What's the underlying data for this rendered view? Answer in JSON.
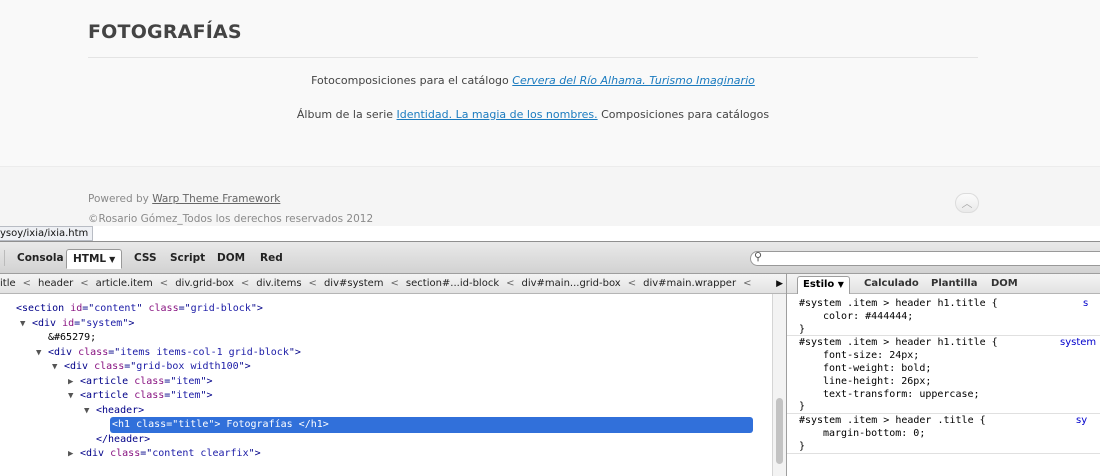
{
  "page": {
    "title": "FOTOGRAFÍAS",
    "para1_text": "Fotocomposiciones para el catálogo ",
    "para1_link": "Cervera del Río Alhama. Turismo Imaginario",
    "para2_text_before": "Álbum de la serie ",
    "para2_link": "Identidad. La magia de los nombres.",
    "para2_text_after": " Composiciones para catálogos",
    "footer_powered_prefix": "Powered by ",
    "footer_powered_link": "Warp Theme Framework",
    "footer_copyright": "©Rosario Gómez_Todos los derechos reservados 2012",
    "to_top_icon": "chevron-up-icon",
    "status_url": "ysoy/ixia/ixia.htm"
  },
  "firebug": {
    "tabs": [
      {
        "label": "Consola"
      },
      {
        "label": "HTML",
        "active": true
      },
      {
        "label": "CSS"
      },
      {
        "label": "Script"
      },
      {
        "label": "DOM"
      },
      {
        "label": "Red"
      }
    ],
    "search_icon": "search-icon",
    "breadcrumbs": [
      "itle",
      "header",
      "article.item",
      "div.grid-box",
      "div.items",
      "div#system",
      "section#...id-block",
      "div#main...grid-box",
      "div#main.wrapper"
    ],
    "breadcrumb_sep": "<",
    "tree": [
      {
        "indent": 0,
        "twisty": "",
        "parts": [
          [
            "c-tag",
            "<section "
          ],
          [
            "c-attr",
            "id"
          ],
          [
            "c-tag",
            "=\""
          ],
          [
            "c-val",
            "content"
          ],
          [
            "c-tag",
            "\" "
          ],
          [
            "c-attr",
            "class"
          ],
          [
            "c-tag",
            "=\""
          ],
          [
            "c-val",
            "grid-block"
          ],
          [
            "c-tag",
            "\">"
          ]
        ]
      },
      {
        "indent": 1,
        "twisty": "▼",
        "parts": [
          [
            "c-tag",
            "<div "
          ],
          [
            "c-attr",
            "id"
          ],
          [
            "c-tag",
            "=\""
          ],
          [
            "c-val",
            "system"
          ],
          [
            "c-tag",
            "\">"
          ]
        ]
      },
      {
        "indent": 2,
        "twisty": "",
        "parts": [
          [
            "c-text",
            "&#65279;"
          ]
        ]
      },
      {
        "indent": 2,
        "twisty": "▼",
        "parts": [
          [
            "c-tag",
            "<div "
          ],
          [
            "c-attr",
            "class"
          ],
          [
            "c-tag",
            "=\""
          ],
          [
            "c-val",
            "items items-col-1 grid-block"
          ],
          [
            "c-tag",
            "\">"
          ]
        ]
      },
      {
        "indent": 3,
        "twisty": "▼",
        "parts": [
          [
            "c-tag",
            "<div "
          ],
          [
            "c-attr",
            "class"
          ],
          [
            "c-tag",
            "=\""
          ],
          [
            "c-val",
            "grid-box width100"
          ],
          [
            "c-tag",
            "\">"
          ]
        ]
      },
      {
        "indent": 4,
        "twisty": "▶",
        "parts": [
          [
            "c-tag",
            "<article "
          ],
          [
            "c-attr",
            "class"
          ],
          [
            "c-tag",
            "=\""
          ],
          [
            "c-val",
            "item"
          ],
          [
            "c-tag",
            "\">"
          ]
        ]
      },
      {
        "indent": 4,
        "twisty": "▼",
        "parts": [
          [
            "c-tag",
            "<article "
          ],
          [
            "c-attr",
            "class"
          ],
          [
            "c-tag",
            "=\""
          ],
          [
            "c-val",
            "item"
          ],
          [
            "c-tag",
            "\">"
          ]
        ]
      },
      {
        "indent": 5,
        "twisty": "▼",
        "parts": [
          [
            "c-tag",
            "<header>"
          ]
        ]
      },
      {
        "indent": 6,
        "twisty": "",
        "selected": true,
        "parts": [
          [
            "c-tag",
            "<h1 "
          ],
          [
            "c-attr",
            "class"
          ],
          [
            "c-tag",
            "=\""
          ],
          [
            "c-val",
            "title"
          ],
          [
            "c-tag",
            "\"> "
          ],
          [
            "c-text",
            "Fotografías"
          ],
          [
            "c-tag",
            " </h1>"
          ]
        ]
      },
      {
        "indent": 5,
        "twisty": "",
        "parts": [
          [
            "c-tag",
            "</header>"
          ]
        ]
      },
      {
        "indent": 4,
        "twisty": "▶",
        "parts": [
          [
            "c-tag",
            "<div "
          ],
          [
            "c-attr",
            "class"
          ],
          [
            "c-tag",
            "=\""
          ],
          [
            "c-val",
            "content clearfix"
          ],
          [
            "c-tag",
            "\">"
          ]
        ]
      }
    ],
    "side_tabs": [
      {
        "label": "Estilo",
        "active": true
      },
      {
        "label": "Calculado"
      },
      {
        "label": "Plantilla"
      },
      {
        "label": "DOM"
      }
    ],
    "css_rules": [
      {
        "selector": "#system .item > header h1.title {",
        "source": "s",
        "props": [
          "color: #444444;"
        ]
      },
      {
        "selector": "#system .item > header h1.title {",
        "source": "system",
        "props": [
          "font-size: 24px;",
          "font-weight: bold;",
          "line-height: 26px;",
          "text-transform: uppercase;"
        ]
      },
      {
        "selector": "#system .item > header .title {",
        "source": "sy",
        "props": [
          "margin-bottom: 0;"
        ]
      }
    ]
  },
  "colors": {
    "link": "#1b7bbf",
    "selection": "#3170da",
    "title": "#444444"
  }
}
